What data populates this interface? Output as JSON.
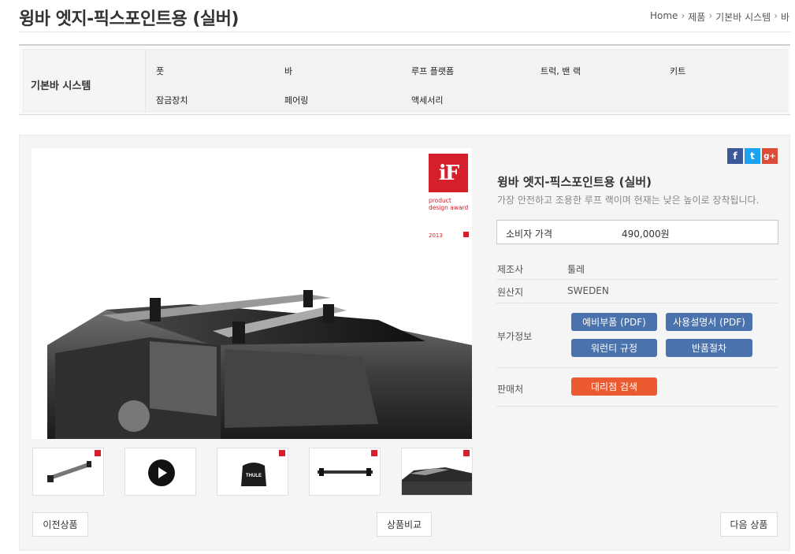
{
  "page": {
    "title": "윙바 엣지-픽스포인트용 (실버)"
  },
  "breadcrumb": {
    "items": [
      "Home",
      "제품",
      "기본바 시스템",
      "바"
    ]
  },
  "category": {
    "title": "기본바 시스템",
    "items": [
      "풋",
      "바",
      "루프 플랫폼",
      "트럭, 밴 랙",
      "키트",
      "잠금장치",
      "페어링",
      "액세서리"
    ]
  },
  "award": {
    "logo": "iF",
    "text_line1": "product",
    "text_line2": "design award",
    "year": "2013"
  },
  "thumbnails": [
    {
      "name": "wingbar-thumb",
      "icon": "roof-bar"
    },
    {
      "name": "video-thumb",
      "icon": "play-icon"
    },
    {
      "name": "foot-thumb",
      "icon": "foot",
      "brand": "THULE"
    },
    {
      "name": "bar-thumb",
      "icon": "bar"
    },
    {
      "name": "car-thumb",
      "icon": "car"
    }
  ],
  "buttons": {
    "prev": "이전상품",
    "compare": "상품비교",
    "next": "다음 상품"
  },
  "social": {
    "facebook": "f",
    "twitter": "t",
    "google": "g+"
  },
  "product": {
    "title": "윙바 엣지-픽스포인트용 (실버)",
    "description": "가장 안전하고 조용한 루프 랙이며 현재는 낮은 높이로 장착됩니다.",
    "price_label": "소비자 가격",
    "price": "490,000원",
    "maker_label": "제조사",
    "maker": "툴레",
    "origin_label": "원산지",
    "origin": "SWEDEN",
    "info_label": "부가정보",
    "info_buttons": [
      "예비부품 (PDF)",
      "사용설명서 (PDF)",
      "워런티 규정",
      "반품절차"
    ],
    "seller_label": "판매처",
    "seller_button": "대리점 검색"
  },
  "colors": {
    "accent_blue": "#4a72ad",
    "accent_orange": "#ec5a2f",
    "if_red": "#d51f2a"
  }
}
